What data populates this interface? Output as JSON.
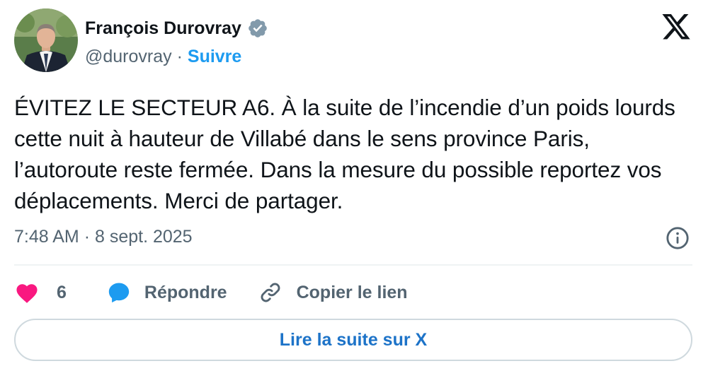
{
  "author": {
    "name": "François Durovray",
    "handle": "@durovray",
    "separator": "·",
    "follow_label": "Suivre"
  },
  "tweet": {
    "text": "ÉVITEZ LE SECTEUR A6. À la suite de l’incendie d’un poids lourds cette nuit à hauteur de Villabé dans le sens province Paris, l’autoroute reste fermée. Dans la mesure du possible reportez vos déplacements. Merci de partager.",
    "time": "7:48 AM",
    "separator": "·",
    "date": "8 sept. 2025"
  },
  "actions": {
    "like_count": "6",
    "reply_label": "Répondre",
    "copy_label": "Copier le lien"
  },
  "read_more_label": "Lire la suite sur X",
  "icons": {
    "verified": "verified-badge-icon",
    "logo": "x-logo-icon",
    "info": "info-icon",
    "like": "heart-icon",
    "reply": "speech-bubble-icon",
    "copy": "link-icon"
  },
  "colors": {
    "accent": "#1d9bf0",
    "like": "#f91880",
    "muted": "#536471",
    "text": "#0f1419",
    "verified": "#829aab"
  }
}
